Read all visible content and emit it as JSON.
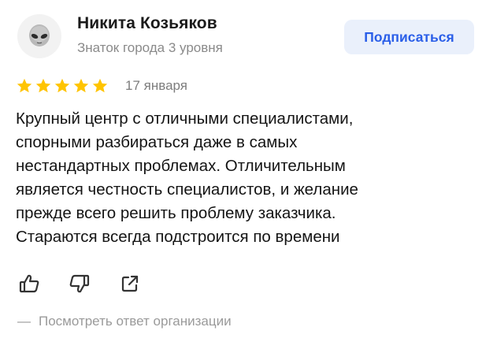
{
  "review": {
    "author_name": "Никита Козьяков",
    "author_level": "Знаток города 3 уровня",
    "subscribe_label": "Подписаться",
    "rating": 5,
    "rating_max": 5,
    "date": "17 января",
    "text_lines": [
      "Крупный центр с отличными специалистами,",
      "спорными разбираться даже в самых",
      "нестандартных проблемах. Отличительным",
      "является честность специалистов, и желание",
      "прежде всего решить проблему заказчика.",
      "Стараются всегда подстроится по времени"
    ],
    "reply_dash": "—",
    "reply_label": "Посмотреть ответ организации"
  },
  "icons": {
    "avatar": "alien-icon",
    "like": "thumbs-up-icon",
    "dislike": "thumbs-down-icon",
    "share": "share-icon",
    "star": "star-icon"
  },
  "colors": {
    "star": "#ffc400",
    "subscribe_bg": "#eaf0fb",
    "subscribe_text": "#2a5ee8",
    "muted_text": "#8a8a8a"
  }
}
